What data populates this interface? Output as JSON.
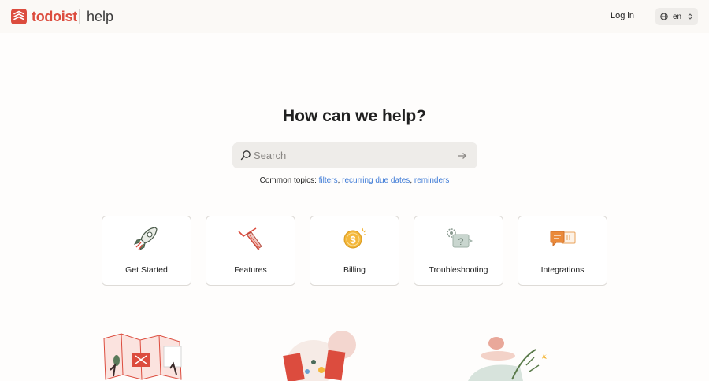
{
  "header": {
    "brand": "todoist",
    "section": "help",
    "login_label": "Log in",
    "language": "en"
  },
  "hero": {
    "title": "How can we help?",
    "search_placeholder": "Search"
  },
  "topics": {
    "prefix": "Common topics:",
    "items": [
      "filters",
      "recurring due dates",
      "reminders"
    ],
    "separator": ","
  },
  "categories": [
    {
      "label": "Get Started",
      "icon": "rocket-icon"
    },
    {
      "label": "Features",
      "icon": "checkmark-pen-icon"
    },
    {
      "label": "Billing",
      "icon": "coin-icon"
    },
    {
      "label": "Troubleshooting",
      "icon": "gear-question-icon"
    },
    {
      "label": "Integrations",
      "icon": "chat-bubbles-icon"
    }
  ],
  "colors": {
    "brand": "#dc4c3e",
    "link": "#3d7ad6",
    "search_bg": "#eeece9",
    "card_border": "#dedbd7"
  }
}
